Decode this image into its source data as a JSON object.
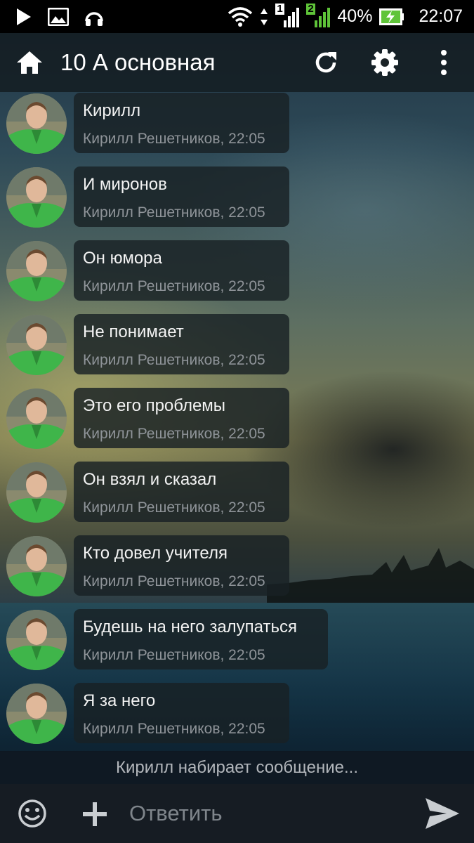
{
  "status_bar": {
    "battery_percent": "40%",
    "time": "22:07",
    "sim1": "1",
    "sim2": "2",
    "left_icons": [
      "play-icon",
      "image-icon",
      "headset-icon"
    ],
    "right_icons": [
      "wifi-icon",
      "signal-icon",
      "battery-charging-icon"
    ]
  },
  "app_bar": {
    "title": "10 А основная",
    "icons": [
      "home-icon",
      "refresh-icon",
      "settings-icon",
      "more-vert-icon"
    ]
  },
  "messages": [
    {
      "text": "Кирилл",
      "meta": "Кирилл Решетников, 22:05"
    },
    {
      "text": "И миронов",
      "meta": "Кирилл Решетников, 22:05"
    },
    {
      "text": "Он юмора",
      "meta": "Кирилл Решетников, 22:05"
    },
    {
      "text": "Не понимает",
      "meta": "Кирилл Решетников, 22:05"
    },
    {
      "text": "Это его проблемы",
      "meta": "Кирилл Решетников, 22:05"
    },
    {
      "text": "Он взял и сказал",
      "meta": "Кирилл Решетников, 22:05"
    },
    {
      "text": "Кто довел учителя",
      "meta": "Кирилл Решетников, 22:05"
    },
    {
      "text": "Будешь на него залупаться",
      "meta": "Кирилл Решетников, 22:05"
    },
    {
      "text": "Я за него",
      "meta": "Кирилл Решетников, 22:05"
    }
  ],
  "typing_indicator": "Кирилл набирает сообщение...",
  "compose": {
    "placeholder": "Ответить",
    "value": "",
    "icons": [
      "emoji-icon",
      "add-icon",
      "send-icon"
    ]
  },
  "colors": {
    "status_bar": "#000000",
    "app_bar": "#121a1e",
    "bubble": "#192124",
    "compose_bar": "#161c23",
    "avatar_jacket": "#3fb54a"
  }
}
